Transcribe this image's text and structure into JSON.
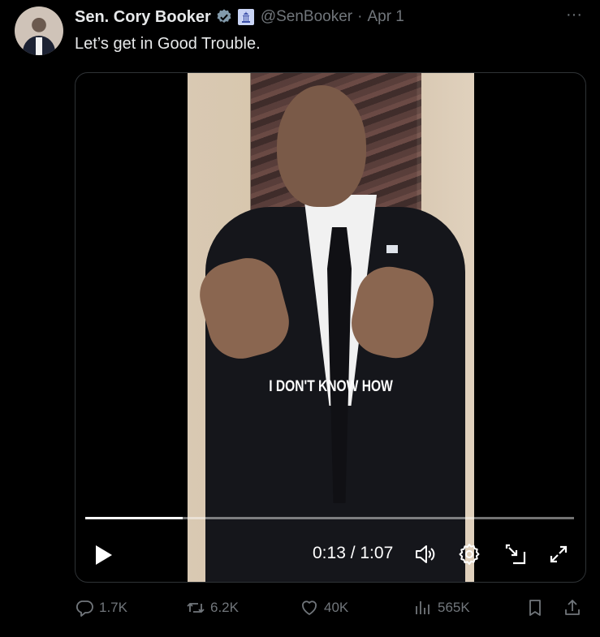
{
  "tweet": {
    "author_name": "Sen. Cory Booker",
    "handle": "@SenBooker",
    "separator": "·",
    "date": "Apr 1",
    "more_label": "···",
    "text": "Let’s get in Good Trouble."
  },
  "video": {
    "caption": "I DON'T KNOW HOW",
    "current_time": "0:13",
    "duration": "1:07",
    "time_display": "0:13 / 1:07",
    "progress": 0.2,
    "icons": [
      "play-icon",
      "volume-icon",
      "settings-icon",
      "picture-in-picture-icon",
      "fullscreen-icon"
    ]
  },
  "actions": {
    "replies": "1.7K",
    "reposts": "6.2K",
    "likes": "40K",
    "views": "565K"
  },
  "colors": {
    "background": "#000000",
    "text": "#e7e9ea",
    "muted": "#71767b",
    "verified": "#829aab",
    "border": "#2f3336"
  }
}
